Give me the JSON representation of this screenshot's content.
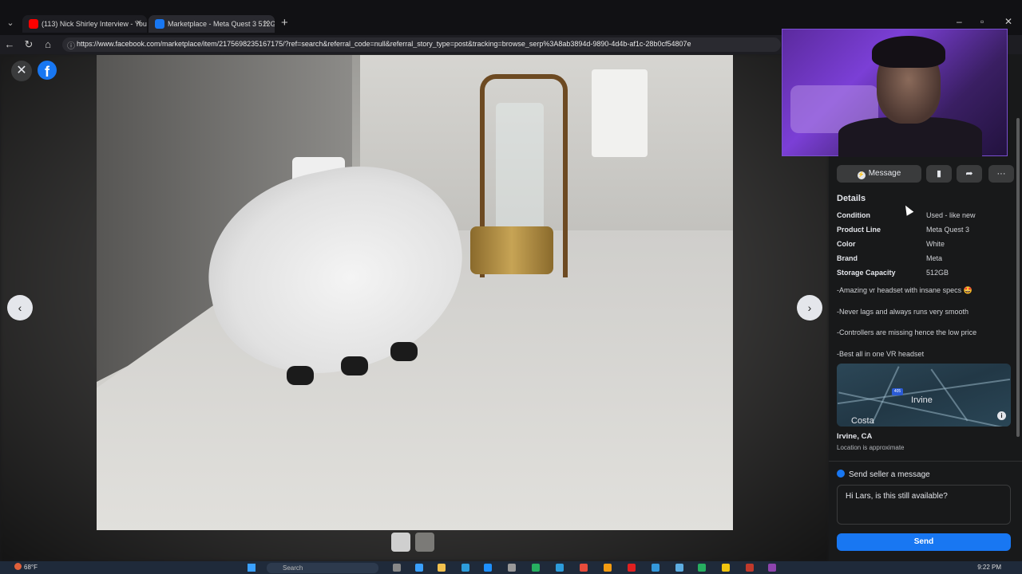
{
  "browser": {
    "tabs": [
      {
        "label": "(113) Nick Shirley Interview - YouTu",
        "favicon_color": "#ff0000"
      },
      {
        "label": "Marketplace - Meta Quest 3 512GB",
        "favicon_color": "#1877f2"
      }
    ],
    "url": "https://www.facebook.com/marketplace/item/2175698235167175/?ref=search&referral_code=null&referral_story_type=post&tracking=browse_serp%3A8ab3894d-9890-4d4b-af1c-28b0cf54807e"
  },
  "viewer": {
    "brand_letter": "f",
    "photo_alt": "Meta Quest 3 headset on a kitchen counter next to a lamp"
  },
  "listing": {
    "actions": {
      "message_label": "Message"
    },
    "details_heading": "Details",
    "details": [
      {
        "key": "Condition",
        "value": "Used - like new"
      },
      {
        "key": "Product Line",
        "value": "Meta Quest 3"
      },
      {
        "key": "Color",
        "value": "White"
      },
      {
        "key": "Brand",
        "value": "Meta"
      },
      {
        "key": "Storage Capacity",
        "value": "512GB"
      }
    ],
    "description": [
      "-Amazing vr headset with insane specs 🤩",
      "-Never lags and always runs very smooth",
      "-Controllers are missing hence the low price",
      "-Best all in one VR headset"
    ],
    "map": {
      "label_city": "Irvine",
      "label_other": "Costa",
      "shield": "405"
    },
    "location": {
      "city": "Irvine, CA",
      "note": "Location is approximate"
    },
    "send": {
      "heading": "Send seller a message",
      "message_value": "Hi Lars, is this still available?",
      "button_label": "Send"
    }
  },
  "taskbar": {
    "weather": "68°F",
    "search_placeholder": "Search",
    "clock": "9:22 PM"
  },
  "colors": {
    "accent": "#1877f2",
    "panel_bg": "#18191a"
  }
}
